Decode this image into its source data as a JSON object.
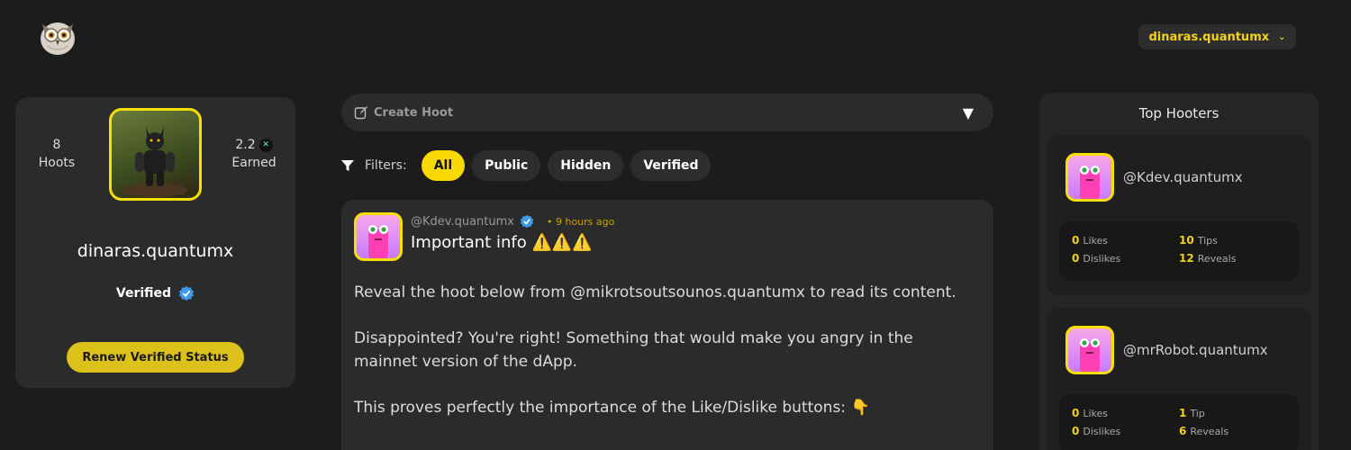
{
  "header": {
    "username": "dinaras.quantumx",
    "menu_icon": "chevron-down-icon"
  },
  "profile": {
    "hoots_count": "8",
    "hoots_label": "Hoots",
    "earned_value": "2.2",
    "earned_label": "Earned",
    "name": "dinaras.quantumx",
    "verified_label": "Verified",
    "renew_button": "Renew Verified Status"
  },
  "create": {
    "label": "Create Hoot"
  },
  "filters": {
    "label": "Filters:",
    "options": [
      "All",
      "Public",
      "Hidden",
      "Verified"
    ],
    "selected": "All"
  },
  "hoot": {
    "user": "@Kdev.quantumx",
    "time": "9 hours ago",
    "title": "Important info ⚠️⚠️⚠️",
    "paragraphs": [
      "Reveal the hoot below from @mikrotsoutsounos.quantumx to read its content.",
      "Disappointed? You're right! Something that would make you angry in the mainnet version of the dApp.",
      "This proves perfectly the importance of the Like/Dislike buttons: 👇"
    ]
  },
  "top_hooters": {
    "title": "Top Hooters",
    "items": [
      {
        "name": "@Kdev.quantumx",
        "likes": "0",
        "likes_label": "Likes",
        "dislikes": "0",
        "dislikes_label": "Dislikes",
        "tips": "10",
        "tips_label": "Tips",
        "reveals": "12",
        "reveals_label": "Reveals"
      },
      {
        "name": "@mrRobot.quantumx",
        "likes": "0",
        "likes_label": "Likes",
        "dislikes": "0",
        "dislikes_label": "Dislikes",
        "tips": "1",
        "tips_label": "Tip",
        "reveals": "6",
        "reveals_label": "Reveals"
      }
    ]
  },
  "colors": {
    "accent": "#f7d800",
    "background": "#1c1c1c",
    "card": "#2b2b2b",
    "verified": "#3d9be9"
  }
}
